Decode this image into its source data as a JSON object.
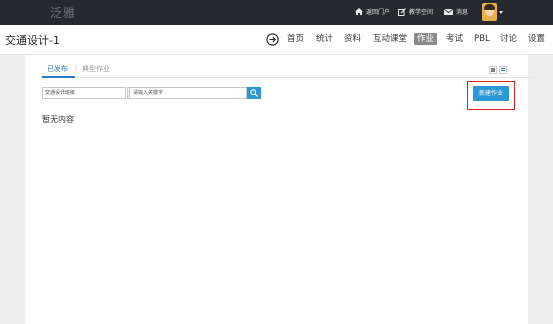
{
  "topbar": {
    "logo": "泛雅",
    "links": [
      {
        "label": "返回门户",
        "icon": "home-icon"
      },
      {
        "label": "教学空间",
        "icon": "edit-icon"
      },
      {
        "label": "消息",
        "icon": "mail-icon"
      }
    ]
  },
  "course": {
    "title": "交通设计-1",
    "nav": [
      "首页",
      "统计",
      "资料",
      "互动课堂",
      "作业",
      "考试",
      "PBL",
      "讨论",
      "设置"
    ],
    "active_nav": "作业"
  },
  "tabs": {
    "published": "已发布",
    "separator": "|",
    "typical": "典型作业"
  },
  "filter": {
    "class_select_value": "交通设计班级",
    "search_placeholder": "请输入关键字"
  },
  "actions": {
    "new_assignment": "新建作业"
  },
  "content": {
    "empty_text": "暂无内容"
  },
  "colors": {
    "accent": "#2b97d4",
    "highlight_frame": "#e02222",
    "topbar": "#262a2e"
  }
}
